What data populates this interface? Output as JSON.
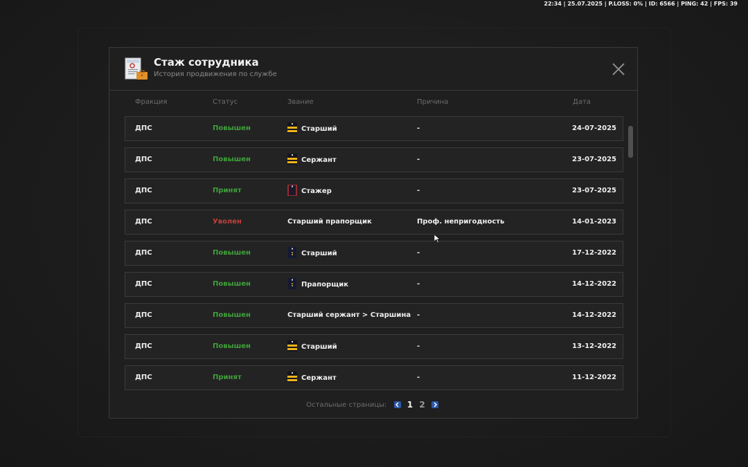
{
  "hud": {
    "text": "22:34 | 25.07.2025 | P.LOSS: 0% | ID: 6566 | PING: 42 | FPS: 39"
  },
  "header": {
    "title": "Стаж сотрудника",
    "subtitle": "История продвижения по службе"
  },
  "columns": {
    "faction": "Фракция",
    "status": "Статус",
    "rank": "Звание",
    "reason": "Причина",
    "date": "Дата"
  },
  "rows": [
    {
      "faction": "ДПС",
      "status": "Повышен",
      "status_type": "promo",
      "rank": "Старший",
      "rank_icon": "stripes-gold-icon",
      "reason": "-",
      "date": "24-07-2025"
    },
    {
      "faction": "ДПС",
      "status": "Повышен",
      "status_type": "promo",
      "rank": "Сержант",
      "rank_icon": "stripes-gold-icon",
      "reason": "-",
      "date": "23-07-2025"
    },
    {
      "faction": "ДПС",
      "status": "Принят",
      "status_type": "hire",
      "rank": "Стажер",
      "rank_icon": "trainee-epaulet-icon",
      "reason": "-",
      "date": "23-07-2025"
    },
    {
      "faction": "ДПС",
      "status": "Уволен",
      "status_type": "fire",
      "rank": "Старший прапорщик",
      "rank_icon": "",
      "reason": "Проф. непригодность",
      "date": "14-01-2023"
    },
    {
      "faction": "ДПС",
      "status": "Повышен",
      "status_type": "promo",
      "rank": "Старший",
      "rank_icon": "navy-epaulet-icon",
      "reason": "-",
      "date": "17-12-2022"
    },
    {
      "faction": "ДПС",
      "status": "Повышен",
      "status_type": "promo",
      "rank": "Прапорщик",
      "rank_icon": "navy-epaulet-icon",
      "reason": "-",
      "date": "14-12-2022"
    },
    {
      "faction": "ДПС",
      "status": "Повышен",
      "status_type": "promo",
      "rank": "Старший сержант > Старшина",
      "rank_icon": "",
      "reason": "-",
      "date": "14-12-2022"
    },
    {
      "faction": "ДПС",
      "status": "Повышен",
      "status_type": "promo",
      "rank": "Старший",
      "rank_icon": "stripes-gold-icon",
      "reason": "-",
      "date": "13-12-2022"
    },
    {
      "faction": "ДПС",
      "status": "Принят",
      "status_type": "hire",
      "rank": "Сержант",
      "rank_icon": "stripes-gold-icon",
      "reason": "-",
      "date": "11-12-2022"
    }
  ],
  "pager": {
    "label": "Остальные страницы:",
    "pages": [
      "1",
      "2"
    ],
    "current": "1"
  },
  "colors": {
    "promo": "#3fa13a",
    "fire": "#c0403a",
    "accent": "#2e58a8"
  }
}
